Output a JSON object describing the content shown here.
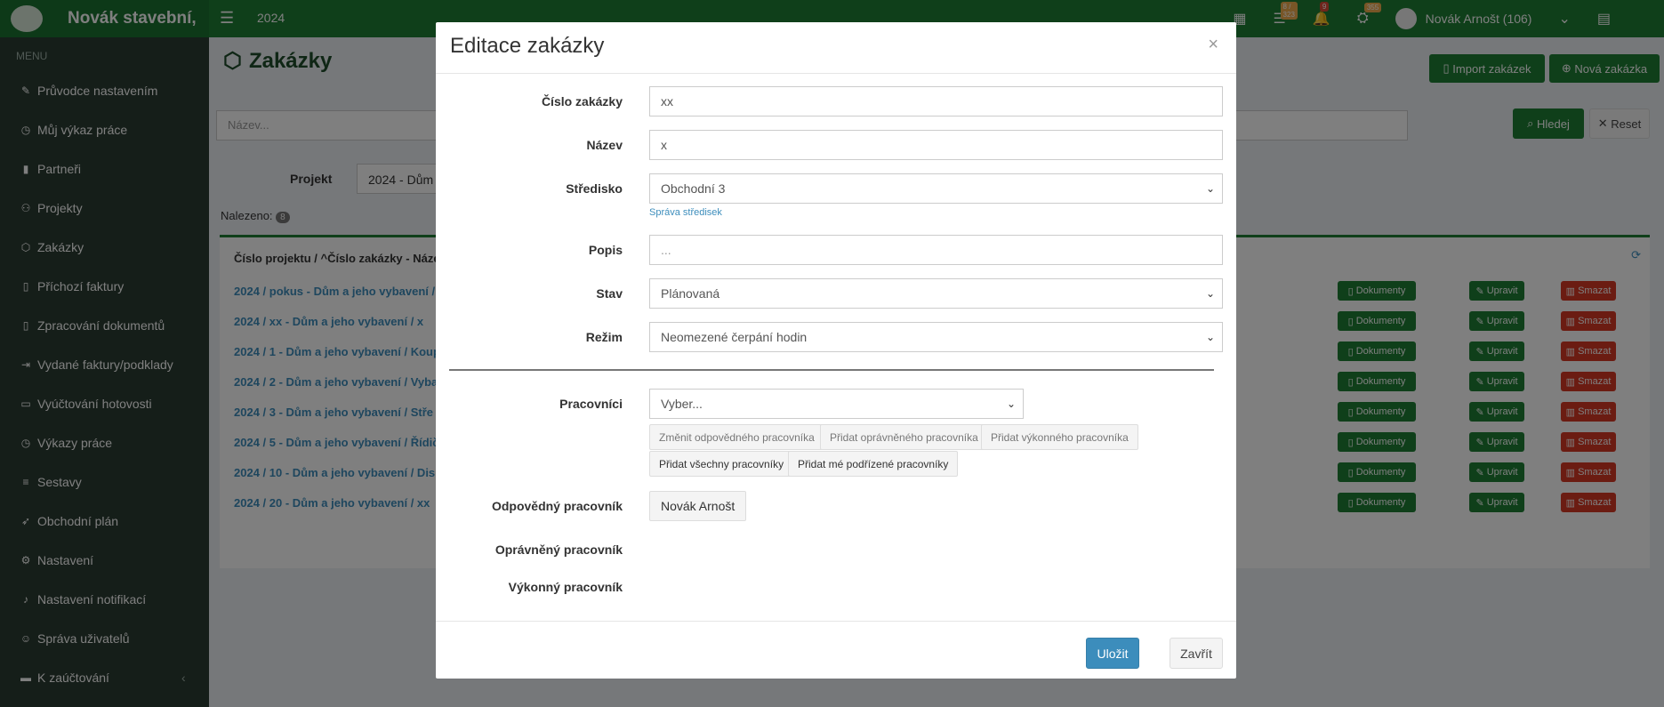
{
  "topbar": {
    "brand": "Novák stavební,",
    "year": "2024",
    "badges": [
      "8 / 323",
      "9",
      "355"
    ],
    "user": "Novák Arnošt (106)"
  },
  "sidebar": {
    "title": "MENU",
    "items": [
      {
        "label": "Průvodce nastavením",
        "icon": "pencil-icon"
      },
      {
        "label": "Můj výkaz práce",
        "icon": "clock-icon"
      },
      {
        "label": "Partneři",
        "icon": "building-icon"
      },
      {
        "label": "Projekty",
        "icon": "sitemap-icon"
      },
      {
        "label": "Zakázky",
        "icon": "cube-icon"
      },
      {
        "label": "Příchozí faktury",
        "icon": "file-icon"
      },
      {
        "label": "Zpracování dokumentů",
        "icon": "file-icon"
      },
      {
        "label": "Vydané faktury/podklady",
        "icon": "file-export-icon"
      },
      {
        "label": "Vyúčtování hotovosti",
        "icon": "money-icon"
      },
      {
        "label": "Výkazy práce",
        "icon": "clock-icon"
      },
      {
        "label": "Sestavy",
        "icon": "list-icon"
      },
      {
        "label": "Obchodní plán",
        "icon": "rocket-icon"
      },
      {
        "label": "Nastavení",
        "icon": "cogs-icon"
      },
      {
        "label": "Nastavení notifikací",
        "icon": "bell-icon"
      },
      {
        "label": "Správa uživatelů",
        "icon": "users-icon"
      },
      {
        "label": "K zaúčtování",
        "icon": "folder-icon"
      }
    ]
  },
  "page": {
    "title": "Zakázky",
    "import_btn": "Import zakázek",
    "new_btn": "Nová zakázka",
    "search_placeholder": "Název...",
    "search_btn": "Hledej",
    "reset_btn": "Reset",
    "project_label": "Projekt",
    "project_value": "2024 - Dům a",
    "found_label": "Nalezeno:",
    "found_count": "8",
    "table_header": "Číslo projektu / ^Číslo zakázky - Náze",
    "rows": [
      "2024 / pokus - Dům a jeho vybavení /",
      "2024 / xx - Dům a jeho vybavení / x",
      "2024 / 1 - Dům a jeho vybavení / Koup",
      "2024 / 2 - Dům a jeho vybavení / Vyba",
      "2024 / 3 - Dům a jeho vybavení / Stře",
      "2024 / 5 - Dům a jeho vybavení / Řídič",
      "2024 / 10 - Dům a jeho vybavení / Disk",
      "2024 / 20 - Dům a jeho vybavení / xx"
    ],
    "row_actions": {
      "docs": "Dokumenty",
      "edit": "Upravit",
      "delete": "Smazat"
    }
  },
  "modal": {
    "title": "Editace zakázky",
    "close": "×",
    "fields": {
      "cislo_label": "Číslo zakázky",
      "cislo_value": "xx",
      "nazev_label": "Název",
      "nazev_value": "x",
      "stredisko_label": "Středisko",
      "stredisko_value": "Obchodní 3",
      "sprava_link": "Správa středisek",
      "popis_label": "Popis",
      "popis_placeholder": "...",
      "stav_label": "Stav",
      "stav_value": "Plánovaná",
      "rezim_label": "Režim",
      "rezim_value": "Neomezené čerpání hodin",
      "pracovnici_label": "Pracovníci",
      "pracovnici_value": "Vyber...",
      "btn_zmenit": "Změnit odpovědného pracovníka",
      "btn_opravneny": "Přidat oprávněného pracovníka",
      "btn_vykonny": "Přidat výkonného pracovníka",
      "btn_vsechny": "Přidat všechny pracovníky",
      "btn_podrizene": "Přidat mé podřízené pracovníky",
      "odpovedny_label": "Odpovědný pracovník",
      "odpovedny_value": "Novák Arnošt",
      "opravneny_label": "Oprávněný pracovník",
      "vykonny_label": "Výkonný pracovník"
    },
    "save": "Uložit",
    "close_btn": "Zavřít"
  }
}
